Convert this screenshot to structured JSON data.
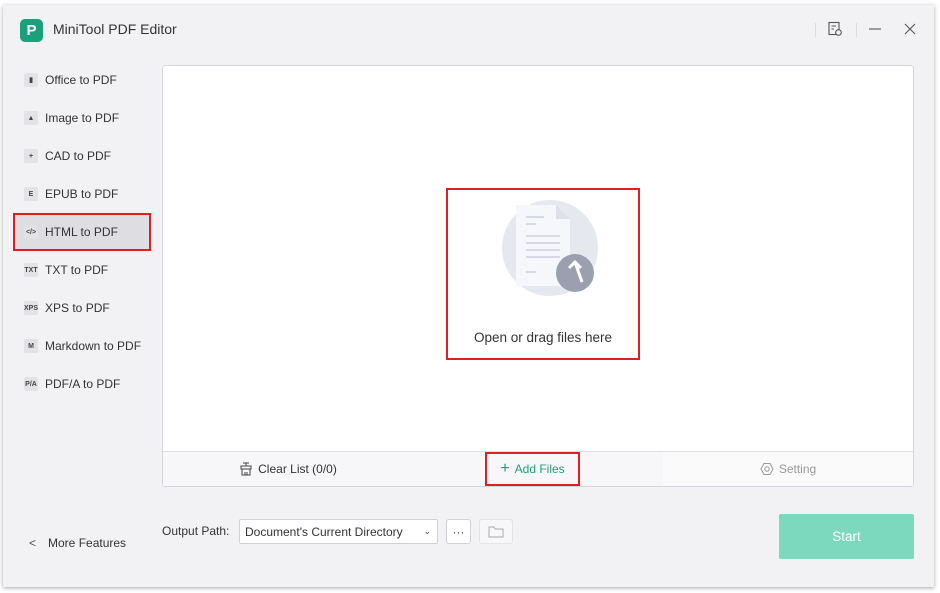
{
  "app": {
    "title": "MiniTool PDF Editor",
    "logo_glyph": "P"
  },
  "titlebar": {
    "icons": [
      "changelog-icon",
      "minimize-icon",
      "close-icon"
    ]
  },
  "sidebar": {
    "items": [
      {
        "label": "Office to PDF",
        "icon": "office-icon",
        "glyph": "▮",
        "active": false
      },
      {
        "label": "Image to PDF",
        "icon": "image-icon",
        "glyph": "▲",
        "active": false
      },
      {
        "label": "CAD to PDF",
        "icon": "cad-icon",
        "glyph": "+",
        "active": false
      },
      {
        "label": "EPUB to PDF",
        "icon": "epub-icon",
        "glyph": "E",
        "active": false
      },
      {
        "label": "HTML to PDF",
        "icon": "html-icon",
        "glyph": "</>",
        "active": true
      },
      {
        "label": "TXT to PDF",
        "icon": "txt-icon",
        "glyph": "TXT",
        "active": false
      },
      {
        "label": "XPS to PDF",
        "icon": "xps-icon",
        "glyph": "XPS",
        "active": false
      },
      {
        "label": "Markdown to PDF",
        "icon": "markdown-icon",
        "glyph": "M",
        "active": false
      },
      {
        "label": "PDF/A to PDF",
        "icon": "pdfa-icon",
        "glyph": "P/A",
        "active": false
      }
    ],
    "more_features": "More Features"
  },
  "dropzone": {
    "text": "Open or drag files here"
  },
  "bottombar": {
    "clear_list": "Clear List (0/0)",
    "add_files": "Add Files",
    "setting": "Setting"
  },
  "footer": {
    "output_label": "Output Path:",
    "output_value": "Document's Current Directory",
    "browse_label": "···",
    "start": "Start"
  },
  "colors": {
    "accent": "#1aa07a",
    "highlight": "#e02020",
    "start_disabled": "#7cd9be"
  }
}
